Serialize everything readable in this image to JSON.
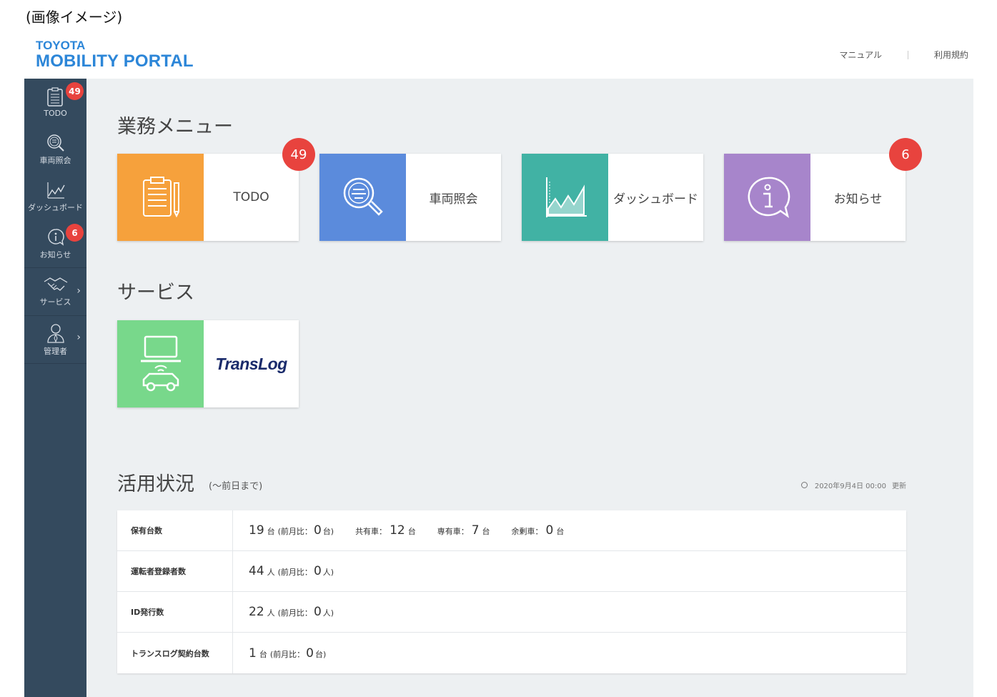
{
  "caption": "(画像イメージ)",
  "logo": {
    "line1": "TOYOTA",
    "line2": "MOBILITY PORTAL"
  },
  "header": {
    "manual": "マニュアル",
    "terms": "利用規約"
  },
  "sidebar": {
    "items": [
      {
        "label": "TODO",
        "badge": "49",
        "icon": "todo-icon"
      },
      {
        "label": "車両照会",
        "icon": "vehicle-search-icon"
      },
      {
        "label": "ダッシュボード",
        "icon": "dashboard-chart-icon"
      },
      {
        "label": "お知らせ",
        "badge": "6",
        "icon": "info-bubble-icon"
      },
      {
        "label": "サービス",
        "icon": "handshake-icon"
      },
      {
        "label": "管理者",
        "icon": "admin-person-icon"
      }
    ]
  },
  "menu": {
    "title": "業務メニュー",
    "cards": [
      {
        "label": "TODO",
        "badge": "49",
        "color": "#f6a13c",
        "icon": "todo-icon"
      },
      {
        "label": "車両照会",
        "color": "#5b8bdc",
        "icon": "vehicle-search-icon"
      },
      {
        "label": "ダッシュボード",
        "color": "#41b2a4",
        "icon": "dashboard-chart-icon"
      },
      {
        "label": "お知らせ",
        "badge": "6",
        "color": "#a785cb",
        "icon": "info-bubble-icon"
      }
    ]
  },
  "services": {
    "title": "サービス",
    "cards": [
      {
        "label": "TransLog",
        "color": "#78d88b",
        "icon": "laptop-car-icon"
      }
    ]
  },
  "usage": {
    "title": "活用状況",
    "subtitle": "(〜前日まで)",
    "updated_date": "2020年9月4日 00:00",
    "updated_label": "更新",
    "rows": [
      {
        "label": "保有台数",
        "value": "19",
        "unit": "台",
        "diff_label": "(前月比：",
        "diff_value": "0",
        "diff_unit": "台)",
        "extras": [
          {
            "label": "共有車：",
            "value": "12",
            "unit": "台"
          },
          {
            "label": "専有車：",
            "value": "7",
            "unit": "台"
          },
          {
            "label": "余剰車：",
            "value": "0",
            "unit": "台"
          }
        ]
      },
      {
        "label": "運転者登録者数",
        "value": "44",
        "unit": "人",
        "diff_label": "(前月比：",
        "diff_value": "0",
        "diff_unit": "人)"
      },
      {
        "label": "ID発行数",
        "value": "22",
        "unit": "人",
        "diff_label": "(前月比：",
        "diff_value": "0",
        "diff_unit": "人)"
      },
      {
        "label": "トランスログ契約台数",
        "value": "1",
        "unit": "台",
        "diff_label": "(前月比：",
        "diff_value": "0",
        "diff_unit": "台)"
      }
    ]
  }
}
